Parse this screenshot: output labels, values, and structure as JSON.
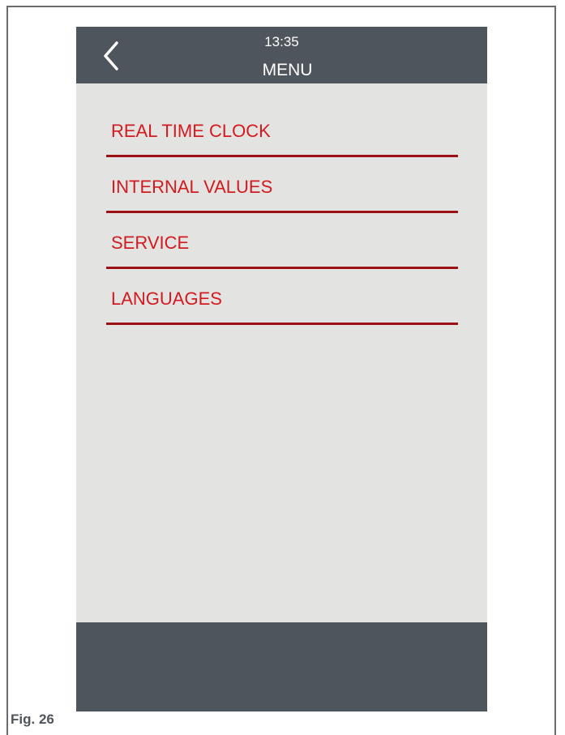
{
  "header": {
    "time": "13:35",
    "title": "MENU",
    "back_icon": "chevron-left-icon"
  },
  "menu": {
    "items": [
      {
        "label": "REAL TIME CLOCK"
      },
      {
        "label": "INTERNAL VALUES"
      },
      {
        "label": "SERVICE"
      },
      {
        "label": "LANGUAGES"
      }
    ]
  },
  "caption": "Fig. 26",
  "colors": {
    "header_bg": "#4f555c",
    "screen_bg": "#e3e3e2",
    "item_text": "#d21a1f",
    "item_rule": "#9b1116"
  }
}
